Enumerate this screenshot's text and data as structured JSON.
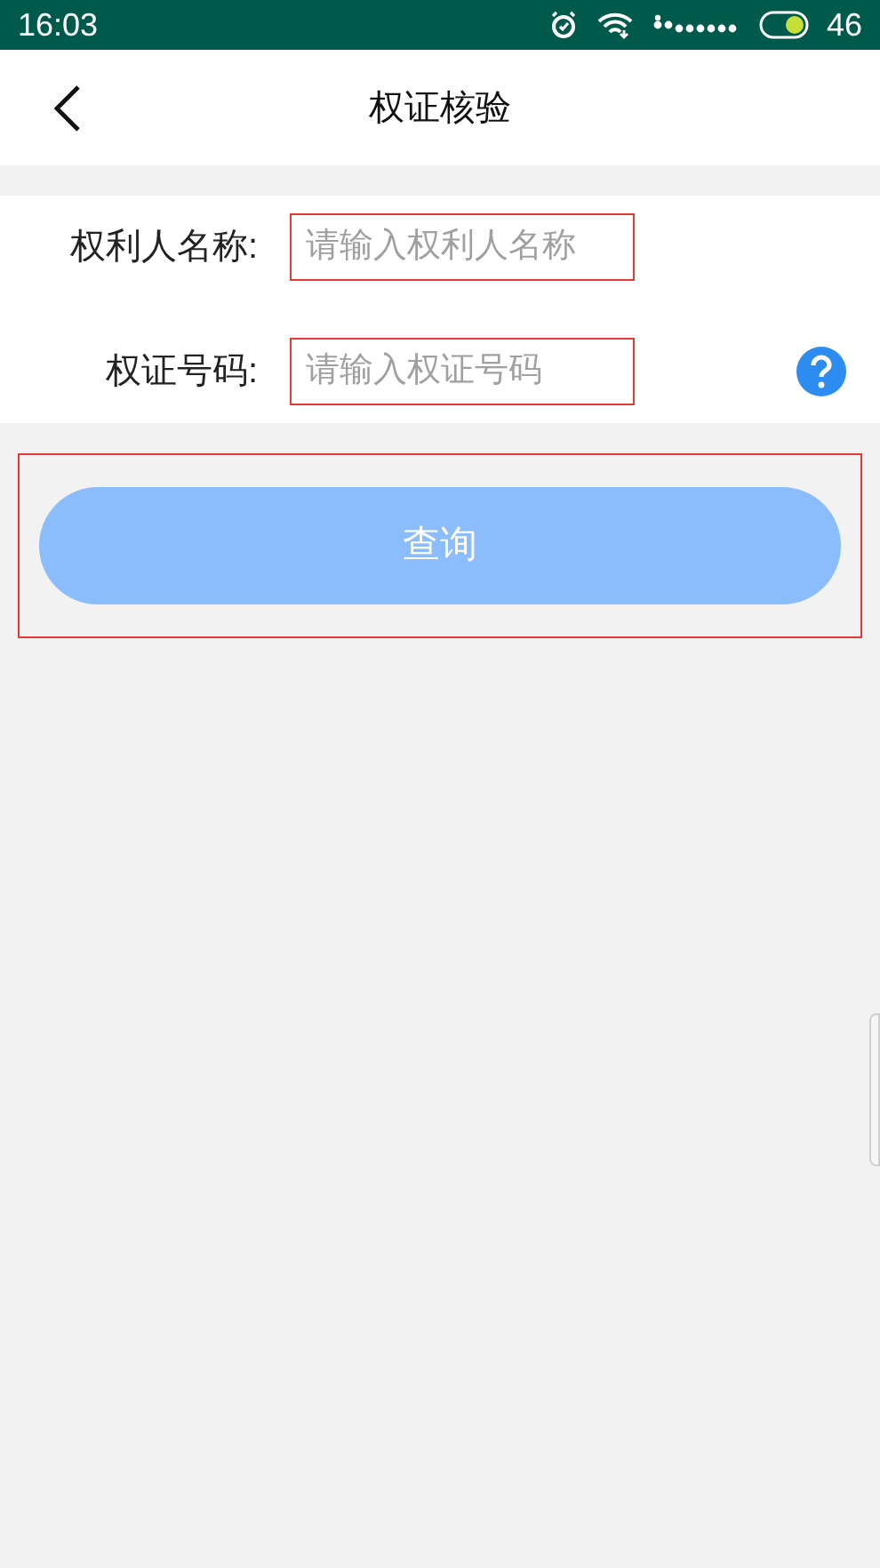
{
  "status_bar": {
    "time": "16:03",
    "battery": "46"
  },
  "header": {
    "title": "权证核验"
  },
  "form": {
    "fields": [
      {
        "label": "权利人名称:",
        "placeholder": "请输入权利人名称",
        "help": false
      },
      {
        "label": "权证号码:",
        "placeholder": "请输入权证号码",
        "help": true
      }
    ]
  },
  "query_button": {
    "label": "查询"
  }
}
